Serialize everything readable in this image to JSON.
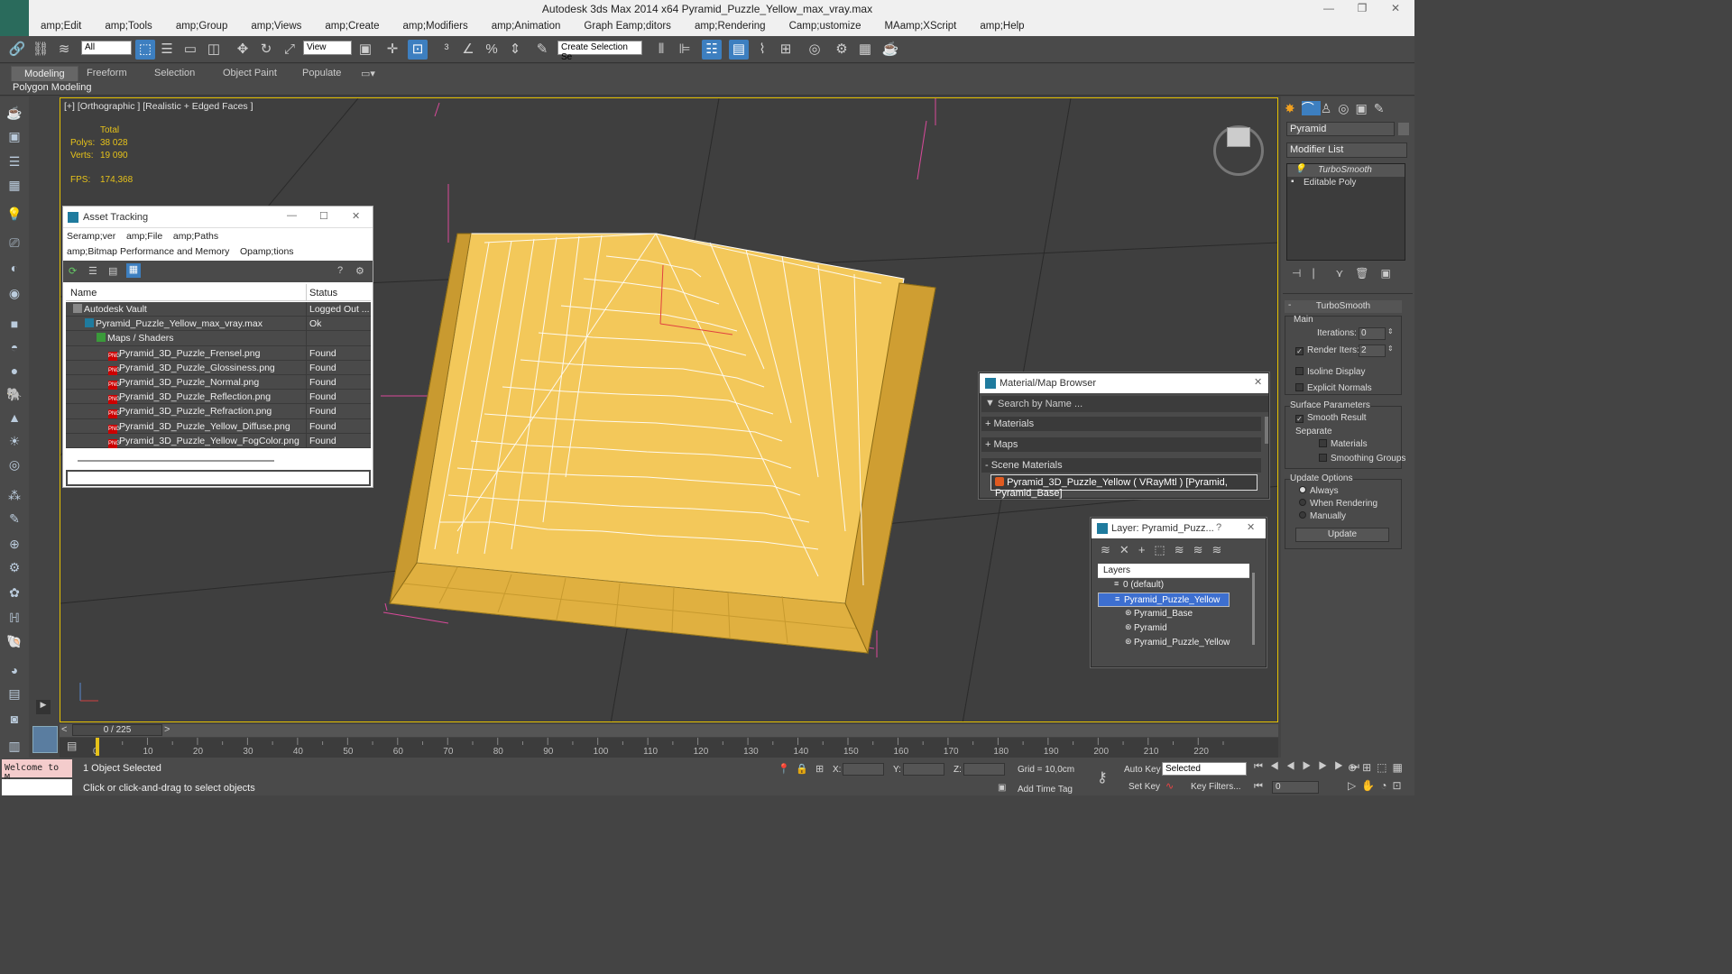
{
  "window": {
    "title": "Autodesk 3ds Max  2014 x64     Pyramid_Puzzle_Yellow_max_vray.max"
  },
  "menu": [
    "amp;Edit",
    "amp;Tools",
    "amp;Group",
    "amp;Views",
    "amp;Create",
    "amp;Modifiers",
    "amp;Animation",
    "Graph Eamp;ditors",
    "amp;Rendering",
    "Camp;ustomize",
    "MAamp;XScript",
    "amp;Help"
  ],
  "toolbar": {
    "filter": "All",
    "refcoord": "View",
    "selset": "Create Selection Se"
  },
  "ribbon": {
    "tabs": [
      "Modeling",
      "Freeform",
      "Selection",
      "Object Paint",
      "Populate"
    ],
    "sub": "Polygon Modeling"
  },
  "viewport": {
    "label": "[+] [Orthographic ] [Realistic + Edged Faces ]",
    "total": "Total",
    "polys_label": "Polys:",
    "polys": "38 028",
    "verts_label": "Verts:",
    "verts": "19 090",
    "fps_label": "FPS:",
    "fps": "174,368"
  },
  "asset": {
    "title": "Asset Tracking",
    "menu1": [
      "Seramp;ver",
      "amp;File",
      "amp;Paths"
    ],
    "menu2": [
      "amp;Bitmap Performance and Memory",
      "Opamp;tions"
    ],
    "col_name": "Name",
    "col_status": "Status",
    "rows": [
      {
        "name": "Autodesk Vault",
        "status": "Logged Out ...",
        "indent": 0,
        "icon": "vault-icon"
      },
      {
        "name": "Pyramid_Puzzle_Yellow_max_vray.max",
        "status": "Ok",
        "indent": 1,
        "icon": "max-file-icon"
      },
      {
        "name": "Maps / Shaders",
        "status": "",
        "indent": 2,
        "icon": "maps-icon"
      },
      {
        "name": "Pyramid_3D_Puzzle_Frensel.png",
        "status": "Found",
        "indent": 3,
        "icon": "png-icon"
      },
      {
        "name": "Pyramid_3D_Puzzle_Glossiness.png",
        "status": "Found",
        "indent": 3,
        "icon": "png-icon"
      },
      {
        "name": "Pyramid_3D_Puzzle_Normal.png",
        "status": "Found",
        "indent": 3,
        "icon": "png-icon"
      },
      {
        "name": "Pyramid_3D_Puzzle_Reflection.png",
        "status": "Found",
        "indent": 3,
        "icon": "png-icon"
      },
      {
        "name": "Pyramid_3D_Puzzle_Refraction.png",
        "status": "Found",
        "indent": 3,
        "icon": "png-icon"
      },
      {
        "name": "Pyramid_3D_Puzzle_Yellow_Diffuse.png",
        "status": "Found",
        "indent": 3,
        "icon": "png-icon"
      },
      {
        "name": "Pyramid_3D_Puzzle_Yellow_FogColor.png",
        "status": "Found",
        "indent": 3,
        "icon": "png-icon"
      }
    ]
  },
  "matbrowser": {
    "title": "Material/Map Browser",
    "search": "Search by Name ...",
    "materials": "+ Materials",
    "maps": "+ Maps",
    "scene": "- Scene Materials",
    "item": "Pyramid_3D_Puzzle_Yellow  ( VRayMtl ) [Pyramid, Pyramid_Base]"
  },
  "layer": {
    "title": "Layer: Pyramid_Puzz...",
    "help": "?",
    "header": "Layers",
    "rows": [
      {
        "name": "0 (default)",
        "sel": false,
        "indent": 0
      },
      {
        "name": "Pyramid_Puzzle_Yellow",
        "sel": true,
        "indent": 0
      },
      {
        "name": "Pyramid_Base",
        "sel": false,
        "indent": 1
      },
      {
        "name": "Pyramid",
        "sel": false,
        "indent": 1
      },
      {
        "name": "Pyramid_Puzzle_Yellow",
        "sel": false,
        "indent": 1
      }
    ]
  },
  "cmdpanel": {
    "objname": "Pyramid",
    "modlist": "Modifier List",
    "stack": [
      "TurboSmooth",
      "Editable Poly"
    ],
    "rollout": "TurboSmooth",
    "main": "Main",
    "iter_label": "Iterations:",
    "iter": "0",
    "render_label": "Render Iters:",
    "render": "2",
    "isoline": "Isoline Display",
    "explicit": "Explicit Normals",
    "surface": "Surface Parameters",
    "smooth": "Smooth Result",
    "separate": "Separate",
    "materials": "Materials",
    "smoothgroups": "Smoothing Groups",
    "update_opts": "Update Options",
    "always": "Always",
    "whenrender": "When Rendering",
    "manually": "Manually",
    "update": "Update"
  },
  "timeline": {
    "frame": "0 / 225",
    "ticks": [
      "0",
      "10",
      "20",
      "30",
      "40",
      "50",
      "60",
      "70",
      "80",
      "90",
      "100",
      "110",
      "120",
      "130",
      "140",
      "150",
      "160",
      "170",
      "180",
      "190",
      "200",
      "210",
      "220"
    ]
  },
  "status": {
    "welcome": "Welcome to M",
    "selected": "1 Object Selected",
    "hint": "Click or click-and-drag to select objects",
    "x": "X:",
    "y": "Y:",
    "z": "Z:",
    "grid": "Grid = 10,0cm",
    "addtime": "Add Time Tag",
    "autokey": "Auto Key",
    "setkey": "Set Key",
    "keymode": "Selected",
    "keyfilters": "Key Filters...",
    "frameval": "0"
  },
  "colors": {
    "accent": "#3d7fc0",
    "viewport_border": "#e6c200",
    "pyramid": "#f0c040",
    "stats": "#e6c21a"
  }
}
